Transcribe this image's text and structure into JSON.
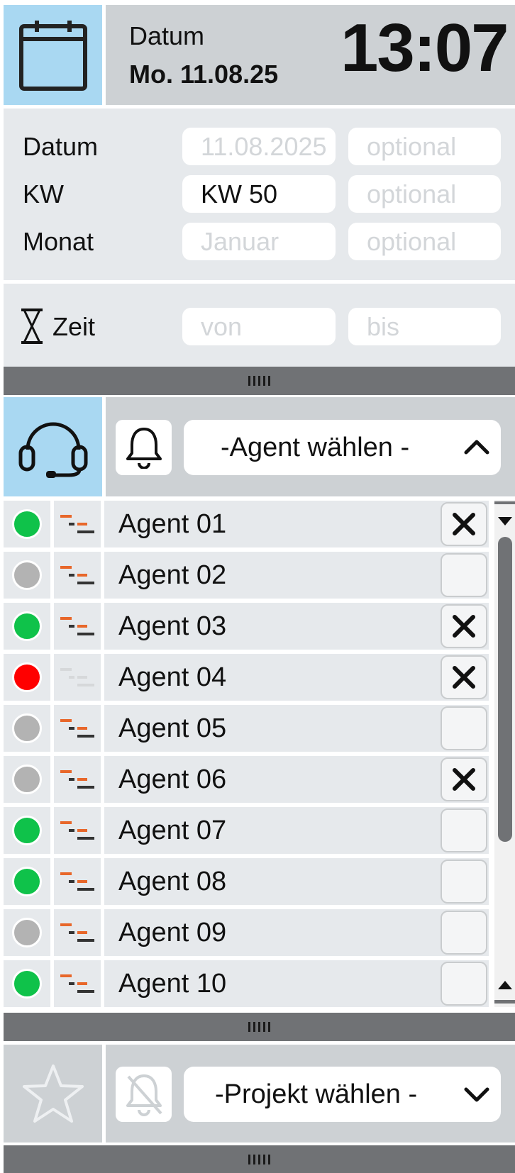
{
  "header": {
    "date_label": "Datum",
    "date_value": "Mo. 11.08.25",
    "clock": "13:07",
    "calendar_icon": "calendar-icon"
  },
  "date_filter": {
    "rows": [
      {
        "label": "Datum",
        "field1": "11.08.2025",
        "field2": "optional"
      },
      {
        "label": "KW",
        "field1": "KW 50",
        "field2": "optional"
      },
      {
        "label": "Monat",
        "field1": "Januar",
        "field2": "optional"
      }
    ]
  },
  "time_filter": {
    "label": "Zeit",
    "from_placeholder": "von",
    "to_placeholder": "bis",
    "icon": "hourglass-icon"
  },
  "agent_panel": {
    "select_label": "-Agent wählen -",
    "headset_icon": "headset-icon",
    "bell_icon": "bell-icon",
    "agents": [
      {
        "name": "Agent 01",
        "status": "green",
        "checked": true,
        "queue_active": true
      },
      {
        "name": "Agent 02",
        "status": "gray",
        "checked": false,
        "queue_active": true
      },
      {
        "name": "Agent 03",
        "status": "green",
        "checked": true,
        "queue_active": true
      },
      {
        "name": "Agent 04",
        "status": "red",
        "checked": true,
        "queue_active": false
      },
      {
        "name": "Agent 05",
        "status": "gray",
        "checked": false,
        "queue_active": true
      },
      {
        "name": "Agent 06",
        "status": "gray",
        "checked": true,
        "queue_active": true
      },
      {
        "name": "Agent 07",
        "status": "green",
        "checked": false,
        "queue_active": true
      },
      {
        "name": "Agent 08",
        "status": "green",
        "checked": false,
        "queue_active": true
      },
      {
        "name": "Agent 09",
        "status": "gray",
        "checked": false,
        "queue_active": true
      },
      {
        "name": "Agent 10",
        "status": "green",
        "checked": false,
        "queue_active": true
      }
    ]
  },
  "project_panel": {
    "select_label": "-Projekt wählen -",
    "star_icon": "star-icon",
    "bell_off_icon": "bell-off-icon"
  },
  "colors": {
    "accent_tile": "#a9d8f2",
    "panel_gray": "#cdd1d4",
    "row_bg": "#e6e9ec",
    "divider": "#707275",
    "status_green": "#0fc24a",
    "status_gray": "#b3b3b3",
    "status_red": "#ff0000",
    "queue_orange": "#e8672a"
  }
}
